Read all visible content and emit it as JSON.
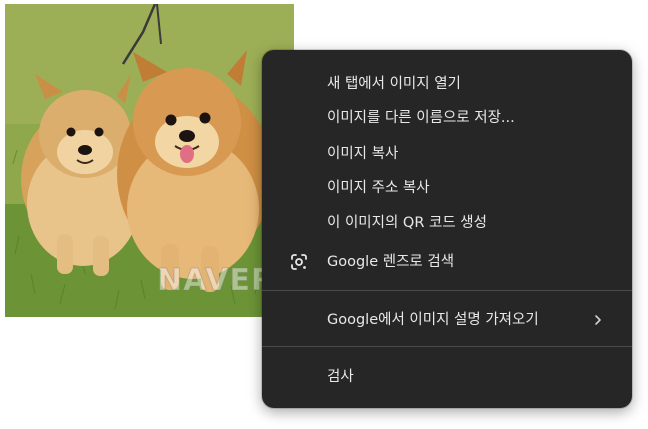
{
  "photo": {
    "watermark": "NAVER"
  },
  "menu": {
    "items": [
      {
        "label": "새 탭에서 이미지 열기"
      },
      {
        "label": "이미지를 다른 이름으로 저장..."
      },
      {
        "label": "이미지 복사"
      },
      {
        "label": "이미지 주소 복사"
      },
      {
        "label": "이 이미지의 QR 코드 생성"
      },
      {
        "label": "Google 렌즈로 검색",
        "icon": "google-lens-icon"
      },
      {
        "label": "Google에서 이미지 설명 가져오기",
        "icon": "chevron-right-icon"
      },
      {
        "label": "검사"
      }
    ]
  },
  "colors": {
    "menu_background": "#262626",
    "menu_text": "#e8e8e8",
    "separator": "#4a4a4a"
  }
}
